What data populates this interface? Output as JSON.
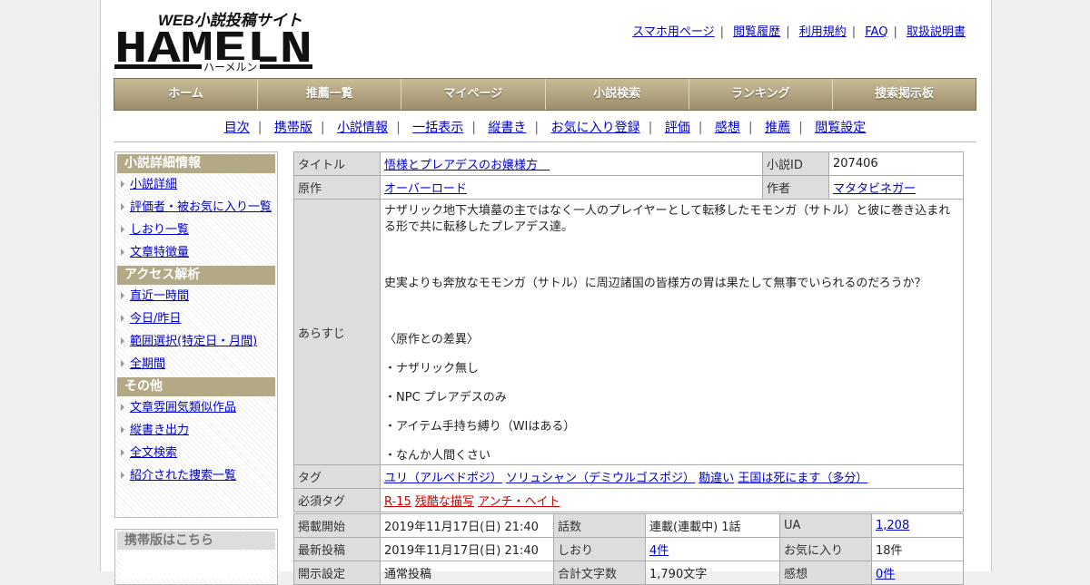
{
  "logo": {
    "tagline": "WEB小説投稿サイト",
    "name": "HAMELN",
    "kana": "ハーメルン"
  },
  "toplinks": [
    "スマホ用ページ",
    "閲覧履歴",
    "利用規約",
    "FAQ",
    "取扱説明書"
  ],
  "nav": [
    "ホーム",
    "推薦一覧",
    "マイページ",
    "小説検索",
    "ランキング",
    "捜索掲示板"
  ],
  "subnav": [
    "目次",
    "携帯版",
    "小説情報",
    "一括表示",
    "縦書き",
    "お気に入り登録",
    "評価",
    "感想",
    "推薦",
    "閲覧設定"
  ],
  "sidebar": {
    "sections": [
      {
        "title": "小説詳細情報",
        "items": [
          "小説詳細",
          "評価者・被お気に入り一覧",
          "しおり一覧",
          "文章特徴量"
        ]
      },
      {
        "title": "アクセス解析",
        "items": [
          "直近一時間",
          "今日/昨日",
          "範囲選択(特定日・月間)",
          "全期間"
        ]
      },
      {
        "title": "その他",
        "items": [
          "文章雰囲気類似作品",
          "縦書き出力",
          "全文検索",
          "紹介された捜索一覧"
        ]
      }
    ],
    "mobile_title": "携帯版はこちら"
  },
  "info": {
    "title_label": "タイトル",
    "title": "悟様とプレアデスのお嬢様方　",
    "id_label": "小説ID",
    "id": "207406",
    "original_label": "原作",
    "original": "オーバーロード",
    "author_label": "作者",
    "author": "マタタビネガー",
    "synopsis_label": "あらすじ",
    "synopsis": [
      "ナザリック地下大墳墓の主ではなく一人のプレイヤーとして転移したモモンガ（サトル）と彼に巻き込まれる形で共に転移したプレアデス達。",
      "史実よりも奔放なモモンガ（サトル）に周辺諸国の皆様方の胃は果たして無事でいられるのだろうか？",
      "〈原作との差異〉",
      "・ナザリック無し",
      "・NPC プレアデスのみ",
      "・アイテム手持ち縛り（WIはある）",
      "・なんか人間くさい"
    ],
    "tags_label": "タグ",
    "tags": [
      "ユリ（アルベドポジ）",
      "ソリュシャン（デミウルゴスポジ）",
      "勘違い",
      "王国は死にます（多分）"
    ],
    "req_tags_label": "必須タグ",
    "req_tags": [
      "R-15",
      "残酷な描写",
      "アンチ・ヘイト"
    ],
    "rows": [
      {
        "l1": "掲載開始",
        "v1": "2019年11月17日(日) 21:40",
        "l2": "話数",
        "v2": "連載(連載中) 1話",
        "l3": "UA",
        "v3": "1,208"
      },
      {
        "l1": "最新投稿",
        "v1": "2019年11月17日(日) 21:40",
        "l2": "しおり",
        "v2": "4件",
        "l3": "お気に入り",
        "v3": "18件"
      },
      {
        "l1": "開示設定",
        "v1": "通常投稿",
        "l2": "合計文字数",
        "v2": "1,790文字",
        "l3": "感想",
        "v3": "0件"
      }
    ]
  }
}
